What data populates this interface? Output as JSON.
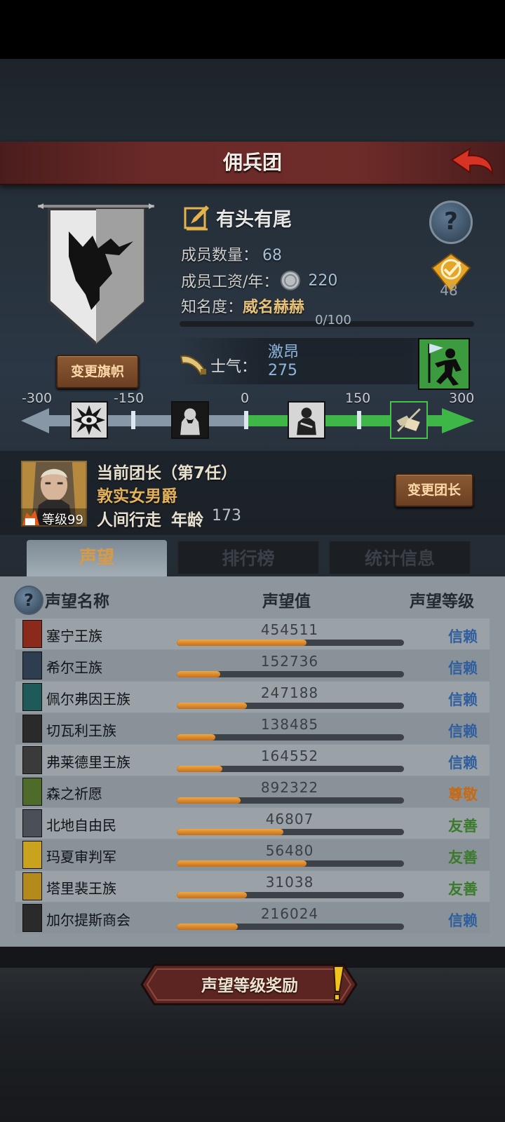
{
  "header": {
    "title": "佣兵团"
  },
  "company": {
    "name": "有头有尾",
    "members_label": "成员数量：",
    "members_value": "68",
    "wage_label": "成员工资/年：",
    "wage_value": "220",
    "fame_label": "知名度：",
    "fame_value": "威名赫赫",
    "fame_progress_text": "0/100",
    "fame_progress": 0,
    "change_flag_label": "变更旗帜",
    "badge_value": "48"
  },
  "morale": {
    "label": "士气：",
    "state": "激昂",
    "value": "275"
  },
  "morale_scale": {
    "ticks": [
      "-300",
      "-150",
      "0",
      "150",
      "300"
    ],
    "stage_icons": [
      "evil-eye-icon",
      "despair-icon",
      "calm-icon",
      "elated-icon"
    ]
  },
  "leader": {
    "title": "当前团长（第7任）",
    "name": "敦实女男爵",
    "trait": "人间行走",
    "age_label": "年龄",
    "age": "173",
    "level_text": "等级99",
    "change_label": "变更团长"
  },
  "tabs": [
    {
      "label": "声望",
      "active": true
    },
    {
      "label": "排行榜",
      "active": false
    },
    {
      "label": "统计信息",
      "active": false
    }
  ],
  "table": {
    "columns": [
      "声望名称",
      "声望值",
      "声望等级"
    ],
    "rows": [
      {
        "name": "塞宁王族",
        "value": "454511",
        "fill": 0.57,
        "level": "信赖",
        "level_color": "#2f5e9e",
        "icon_color": "#8a2a1a"
      },
      {
        "name": "希尔王族",
        "value": "152736",
        "fill": 0.19,
        "level": "信赖",
        "level_color": "#2f5e9e",
        "icon_color": "#2e3d4f"
      },
      {
        "name": "佩尔弗因王族",
        "value": "247188",
        "fill": 0.31,
        "level": "信赖",
        "level_color": "#2f5e9e",
        "icon_color": "#1e5a5a"
      },
      {
        "name": "切瓦利王族",
        "value": "138485",
        "fill": 0.17,
        "level": "信赖",
        "level_color": "#2f5e9e",
        "icon_color": "#2a2a2a"
      },
      {
        "name": "弗莱德里王族",
        "value": "164552",
        "fill": 0.2,
        "level": "信赖",
        "level_color": "#2f5e9e",
        "icon_color": "#3a3a3a"
      },
      {
        "name": "森之祈愿",
        "value": "892322",
        "fill": 0.28,
        "level": "尊敬",
        "level_color": "#c76a14",
        "icon_color": "#4f6b2a"
      },
      {
        "name": "北地自由民",
        "value": "46807",
        "fill": 0.47,
        "level": "友善",
        "level_color": "#3a7a2a",
        "icon_color": "#4a5058"
      },
      {
        "name": "玛夏审判军",
        "value": "56480",
        "fill": 0.57,
        "level": "友善",
        "level_color": "#3a7a2a",
        "icon_color": "#c9a21e"
      },
      {
        "name": "塔里裴王族",
        "value": "31038",
        "fill": 0.31,
        "level": "友善",
        "level_color": "#3a7a2a",
        "icon_color": "#b48a1a"
      },
      {
        "name": "加尔提斯商会",
        "value": "216024",
        "fill": 0.27,
        "level": "信赖",
        "level_color": "#2f5e9e",
        "icon_color": "#2a2a2a"
      }
    ]
  },
  "reward_button": {
    "label": "声望等级奖励"
  }
}
